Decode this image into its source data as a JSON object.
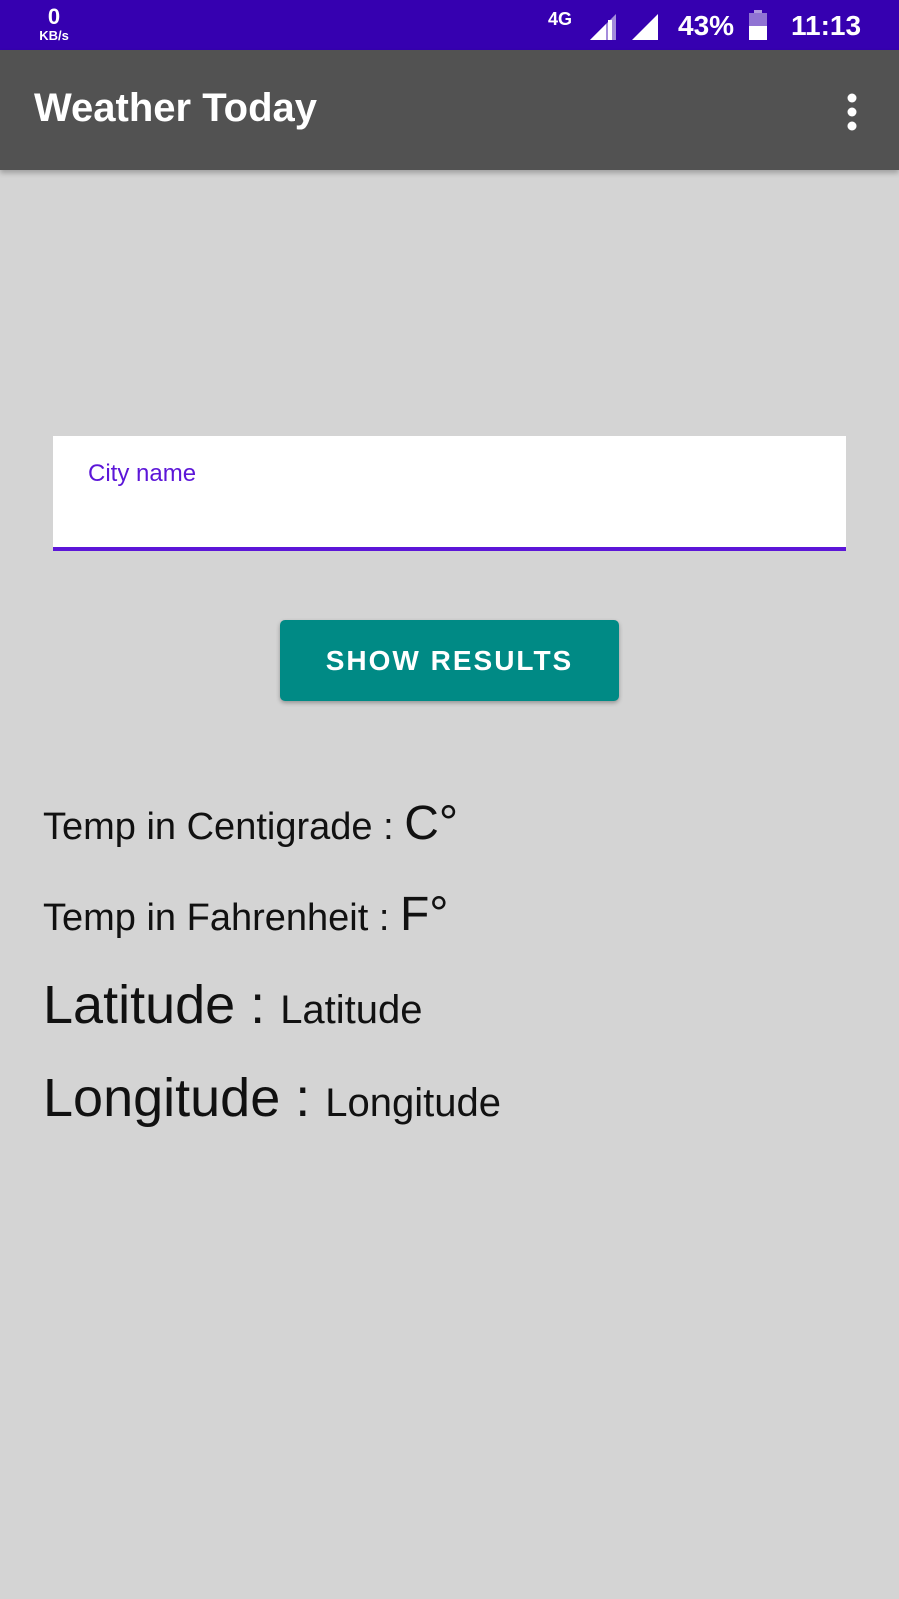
{
  "status_bar": {
    "net_speed_value": "0",
    "net_speed_unit": "KB/s",
    "network_type": "4G",
    "battery_percent": "43%",
    "time": "11:13",
    "background_color": "#3600b0",
    "icons": [
      "signal-icon",
      "signal-icon",
      "battery-icon"
    ]
  },
  "app_bar": {
    "title": "Weather Today",
    "background_color": "#525252",
    "menu_icon": "overflow-menu-icon"
  },
  "form": {
    "city_field": {
      "label": "City name",
      "value": "",
      "accent_color": "#5c16d8"
    },
    "submit_button": {
      "label": "SHOW RESULTS",
      "color": "#008a85"
    }
  },
  "results": {
    "temp_c": {
      "label": "Temp in Centigrade : ",
      "value": "C°"
    },
    "temp_f": {
      "label": "Temp in Fahrenheit : ",
      "value": "F°"
    },
    "latitude": {
      "label": "Latitude : ",
      "value": "Latitude"
    },
    "longitude": {
      "label": "Longitude : ",
      "value": "Longitude"
    }
  }
}
